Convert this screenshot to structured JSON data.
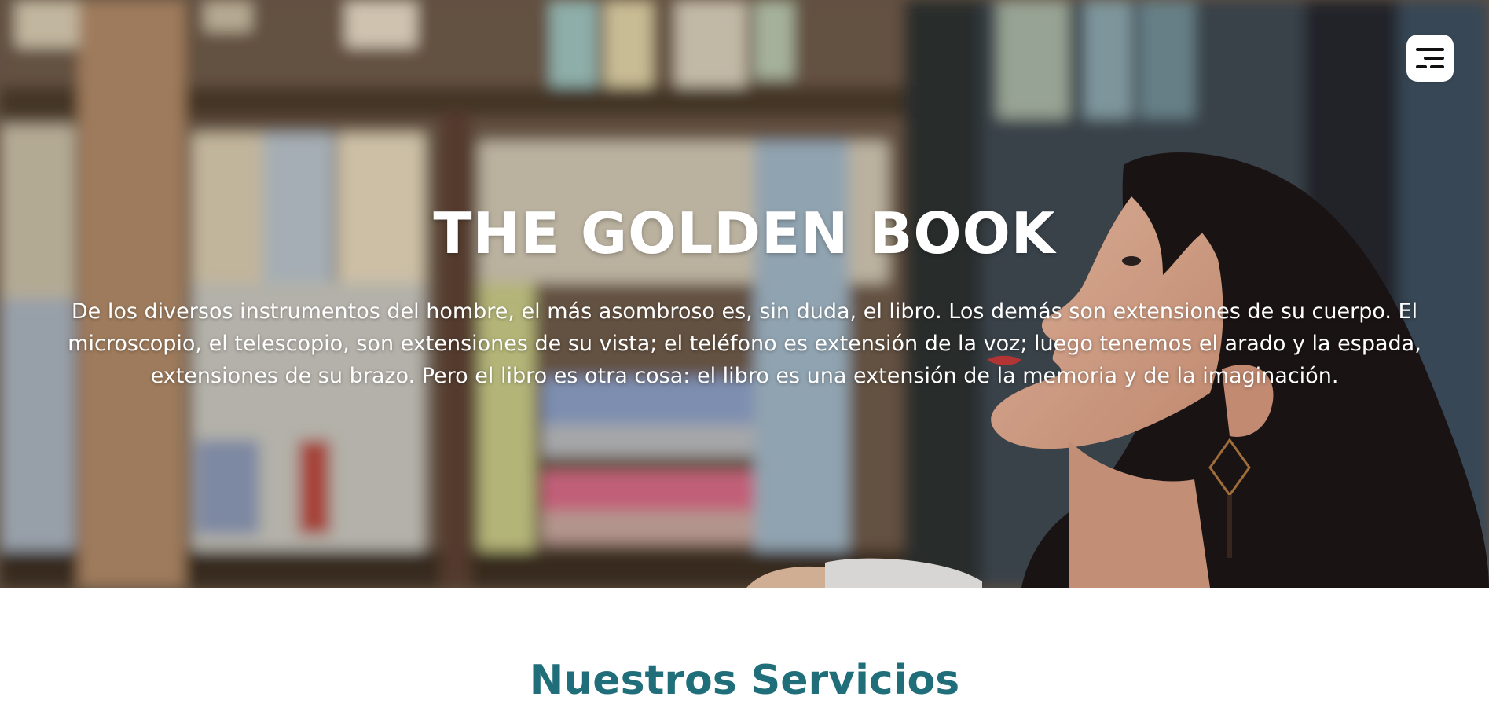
{
  "hero": {
    "title": "THE GOLDEN BOOK",
    "text": "De los diversos instrumentos del hombre, el más asombroso es, sin duda, el libro. Los demás son extensiones de su cuerpo. El microscopio, el telescopio, son extensiones de su vista; el teléfono es extensión de la voz; luego tenemos el arado y la espada, extensiones de su brazo. Pero el libro es otra cosa: el libro es una extensión de la memoria y de la imaginación."
  },
  "menu": {
    "icon": "hamburger-menu-icon"
  },
  "next_section": {
    "heading": "Nuestros Servicios"
  },
  "colors": {
    "heading_accent": "#1f6e7a",
    "hero_text": "#ffffff"
  }
}
